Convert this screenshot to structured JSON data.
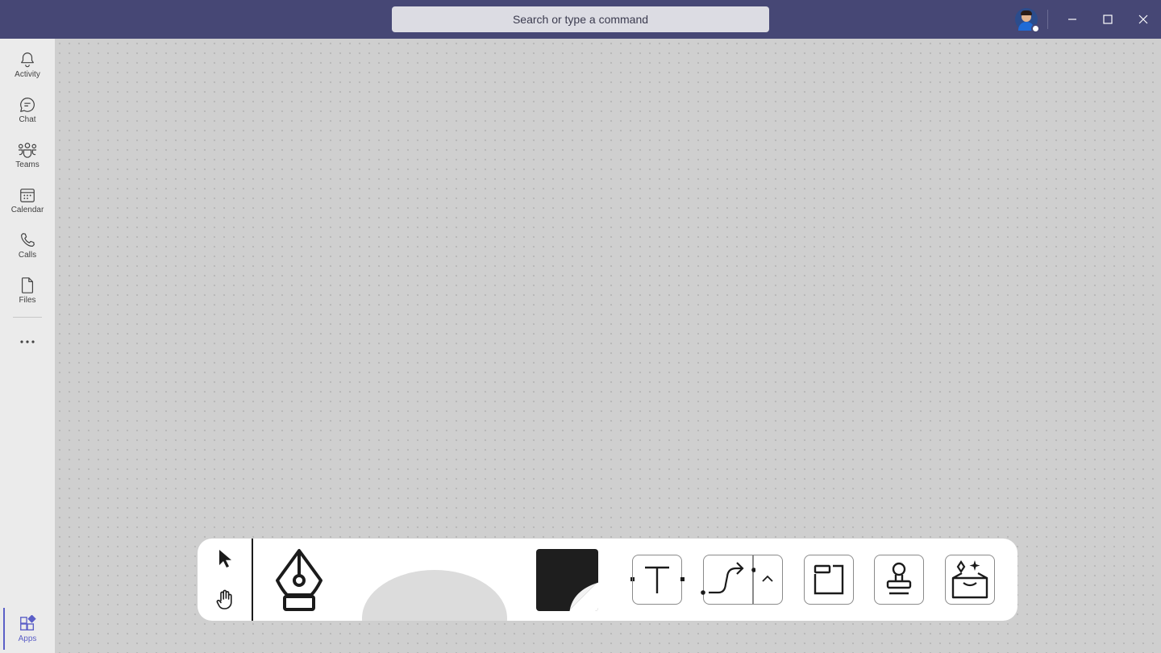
{
  "titlebar": {
    "search_placeholder": "Search or type a command",
    "background_color": "#464775",
    "window_buttons": [
      "minimize-icon",
      "maximize-icon",
      "close-icon"
    ]
  },
  "rail": {
    "items": [
      {
        "label": "Activity",
        "icon": "bell-icon"
      },
      {
        "label": "Chat",
        "icon": "chat-icon"
      },
      {
        "label": "Teams",
        "icon": "teams-icon"
      },
      {
        "label": "Calendar",
        "icon": "calendar-icon"
      },
      {
        "label": "Calls",
        "icon": "phone-icon"
      },
      {
        "label": "Files",
        "icon": "file-icon"
      }
    ],
    "more_icon": "more-icon",
    "apps": {
      "label": "Apps",
      "icon": "apps-icon",
      "active": true
    },
    "accent_color": "#5b5fc7"
  },
  "toolbar": {
    "tools": [
      "select-pointer",
      "pan-hand",
      "pen",
      "shapes",
      "sticky-note",
      "text",
      "connector",
      "frame",
      "stamp",
      "templates"
    ]
  }
}
